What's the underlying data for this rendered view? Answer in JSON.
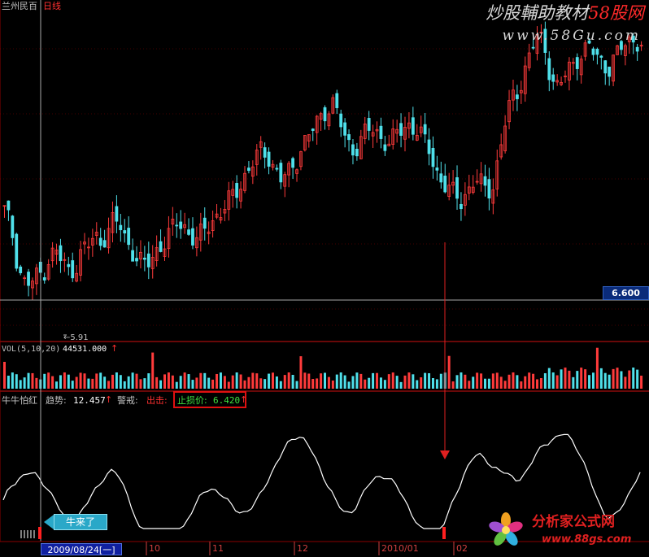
{
  "header": {
    "stock_name": "兰州民百",
    "period": "日线",
    "watermark_title": "炒股輔助教材",
    "watermark_brand": "58股网",
    "watermark_url": "www.58Gu.com"
  },
  "price_panel": {
    "current_price_tag": "6.600",
    "low_marker": "←5.91"
  },
  "volume_panel": {
    "label": "VOL(5,10,20)",
    "value": "44531.000",
    "arrow": "↑"
  },
  "indicator_panel": {
    "name": "牛牛怕红",
    "trend_label": "趋势:",
    "trend_value": "12.457",
    "trend_arrow": "↑",
    "warn_label": "警戒:",
    "out_label": "出击:",
    "stop_label": "止损价:",
    "stop_value": "6.420",
    "stop_arrow": "↑",
    "callout": "牛来了"
  },
  "time_axis": {
    "cursor_date": "2009/08/24[一]",
    "labels": [
      "10",
      "11",
      "12",
      "2010/01",
      "02"
    ]
  },
  "logo": {
    "title": "分析家公式网",
    "url": "www.88gs.com"
  },
  "colors": {
    "up": "#ff3b3b",
    "down": "#4fe0ea",
    "grid": "#8a0000",
    "line": "#ffffff"
  },
  "chart_data": {
    "type": "candlestick",
    "price_ylim": [
      5.5,
      8.6
    ],
    "low_point": 5.91,
    "current_price": 6.6,
    "stop_loss": 6.42,
    "trend_value": 12.457,
    "volume_last": 44531.0,
    "close_series": [
      6.7,
      6.55,
      6.2,
      6.0,
      5.98,
      6.05,
      6.1,
      6.25,
      6.3,
      6.2,
      6.1,
      6.15,
      6.3,
      6.35,
      6.45,
      6.4,
      6.5,
      6.6,
      6.55,
      6.4,
      6.3,
      6.2,
      6.15,
      6.25,
      6.35,
      6.4,
      6.5,
      6.6,
      6.55,
      6.45,
      6.4,
      6.5,
      6.6,
      6.65,
      6.7,
      6.8,
      6.9,
      7.0,
      7.1,
      7.2,
      7.3,
      7.25,
      7.1,
      7.0,
      7.05,
      7.15,
      7.3,
      7.4,
      7.5,
      7.6,
      7.7,
      7.75,
      7.6,
      7.4,
      7.3,
      7.35,
      7.45,
      7.5,
      7.45,
      7.4,
      7.35,
      7.45,
      7.5,
      7.55,
      7.5,
      7.4,
      7.3,
      7.1,
      7.0,
      6.9,
      6.85,
      6.8,
      6.9,
      7.0,
      6.95,
      6.9,
      6.95,
      7.3,
      7.6,
      7.8,
      7.9,
      8.1,
      8.3,
      8.4,
      8.3,
      8.0,
      7.9,
      8.0,
      8.1,
      8.2,
      8.25,
      8.3,
      8.2,
      8.15,
      8.1,
      8.2,
      8.3,
      8.35,
      8.4,
      8.3
    ]
  }
}
